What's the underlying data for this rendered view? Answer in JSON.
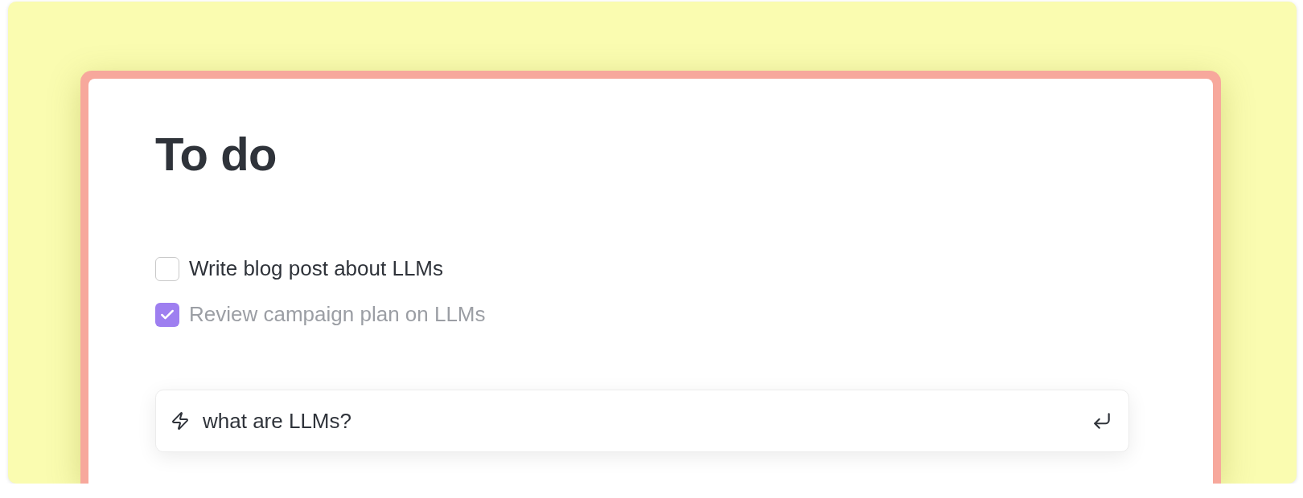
{
  "title": "To do",
  "tasks": [
    {
      "label": "Write blog post about LLMs",
      "checked": false
    },
    {
      "label": "Review campaign plan on LLMs",
      "checked": true
    }
  ],
  "prompt": {
    "value": "what are LLMs?"
  }
}
